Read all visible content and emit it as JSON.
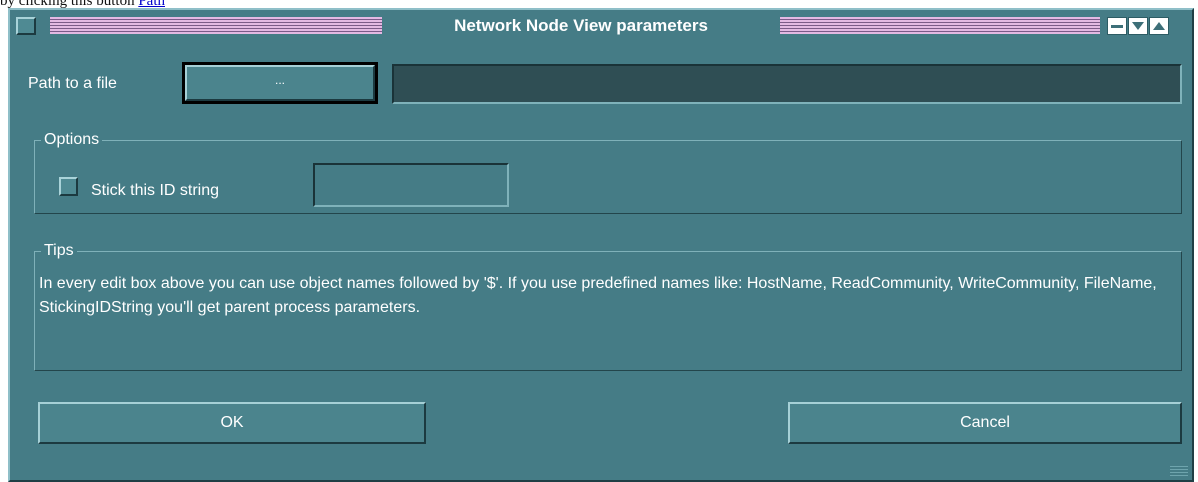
{
  "page": {
    "prefix_text": "by clicking this button",
    "prefix_link": "Path"
  },
  "window": {
    "title": "Network Node View parameters",
    "controls": [
      "minimize-icon",
      "maximize-icon",
      "restore-icon"
    ]
  },
  "path": {
    "label": "Path to a file",
    "browse_label": "...",
    "value": ""
  },
  "options": {
    "legend": "Options",
    "checkbox_label": "Stick this ID string",
    "checked": false,
    "id_value": ""
  },
  "tips": {
    "legend": "Tips",
    "text": "In every edit box above you can use object names followed by '$'. If you use predefined names like: HostName, ReadCommunity, WriteCommunity, FileName, StickingIDString you'll get parent process parameters."
  },
  "buttons": {
    "ok": "OK",
    "cancel": "Cancel"
  },
  "colors": {
    "window_bg": "#457c86",
    "title_stripes": "#e3b9e3",
    "field_dark": "#2f4e54"
  }
}
